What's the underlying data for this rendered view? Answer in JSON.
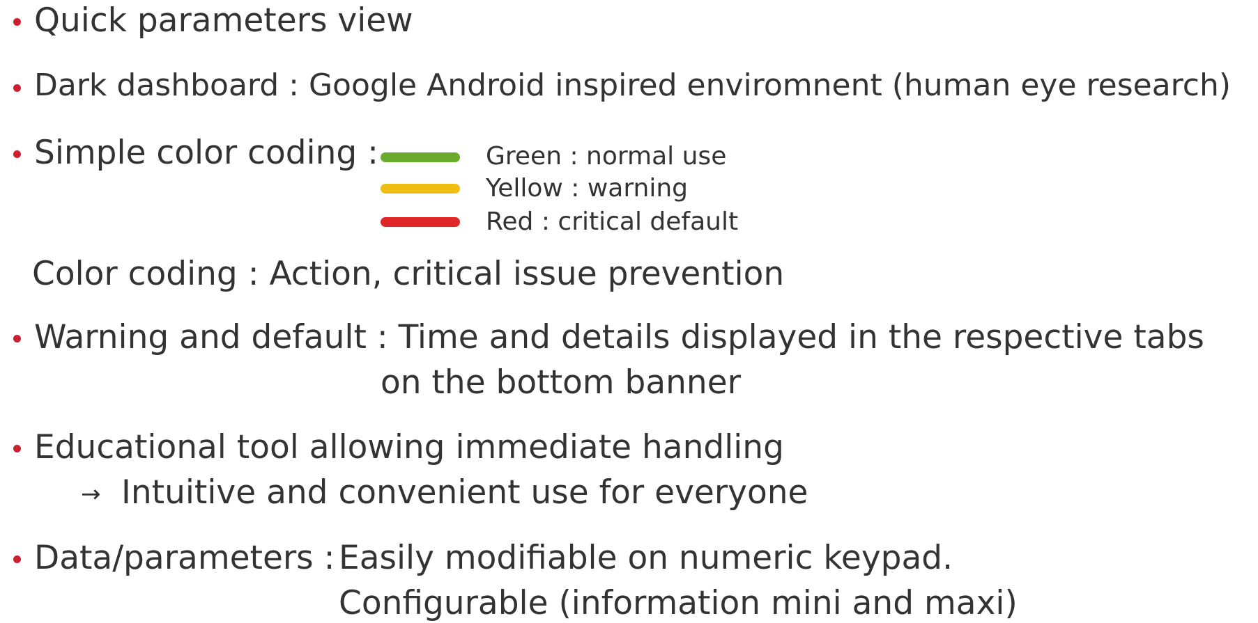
{
  "items": [
    {
      "text": "Quick parameters view"
    },
    {
      "text": "Dark dashboard : Google Android inspired enviromnent  (human eye research)"
    },
    {
      "text": "Simple color coding :"
    },
    {
      "text": "Warning and default : Time and details displayed in the respective tabs",
      "continuation": "on the bottom banner"
    },
    {
      "text": "Educational tool allowing immediate handling",
      "sub_arrow": "→",
      "sub_text": "Intuitive and convenient use for everyone"
    },
    {
      "text": "Data/parameters :",
      "detail_1": "Easily modifiable on numeric keypad.",
      "detail_2": "Configurable (information mini and maxi)"
    }
  ],
  "legend": [
    {
      "label": "Green : normal use",
      "color": "#6aab2e"
    },
    {
      "label": "Yellow : warning",
      "color": "#eebe13"
    },
    {
      "label": "Red : critical default",
      "color": "#e02627"
    }
  ],
  "note": "Color coding : Action, critical issue prevention",
  "bullet_color": "#cc1f2f",
  "text_color": "#333333"
}
